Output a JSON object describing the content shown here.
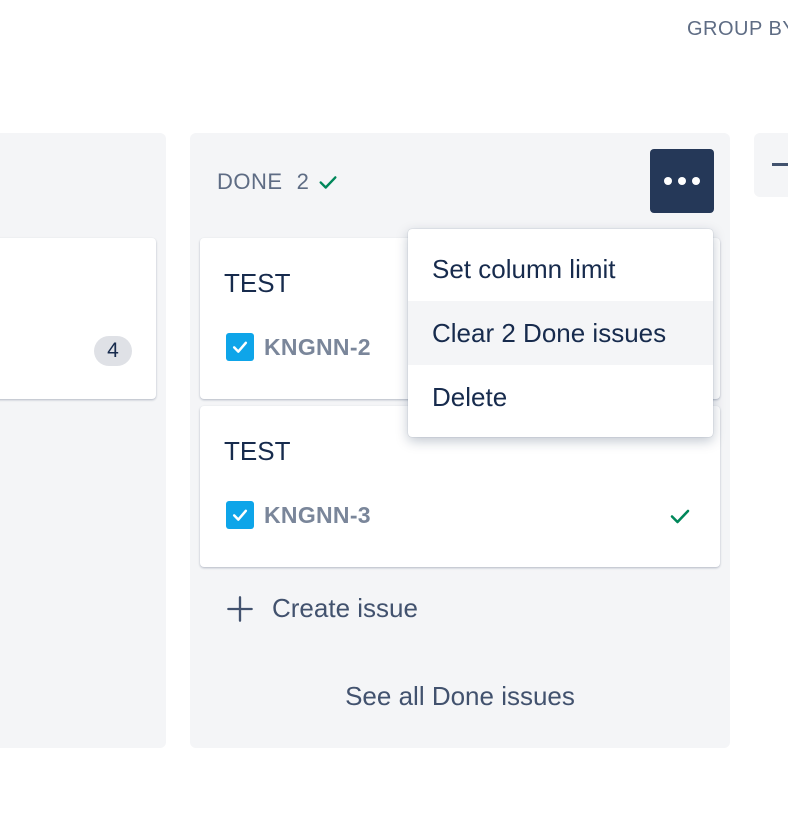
{
  "header": {
    "group_by_label": "GROUP BY"
  },
  "left_column": {
    "card": {
      "badge": "4"
    }
  },
  "done_column": {
    "title": "DONE",
    "count": "2",
    "cards": [
      {
        "title": "TEST",
        "key": "KNGNN-2"
      },
      {
        "title": "TEST",
        "key": "KNGNN-3"
      }
    ],
    "create_issue_label": "Create issue",
    "see_all_label": "See all Done issues"
  },
  "column_menu": {
    "items": [
      {
        "label": "Set column limit"
      },
      {
        "label": "Clear 2 Done issues"
      },
      {
        "label": "Delete"
      }
    ]
  },
  "icons": {
    "more": "more-icon",
    "check": "check-icon",
    "issue_type": "task-checkbox-icon",
    "plus": "plus-icon"
  },
  "colors": {
    "accent_button": "#253858",
    "done_check": "#00875a",
    "task_icon": "#0ea5e9",
    "column_bg": "#f4f5f7"
  }
}
